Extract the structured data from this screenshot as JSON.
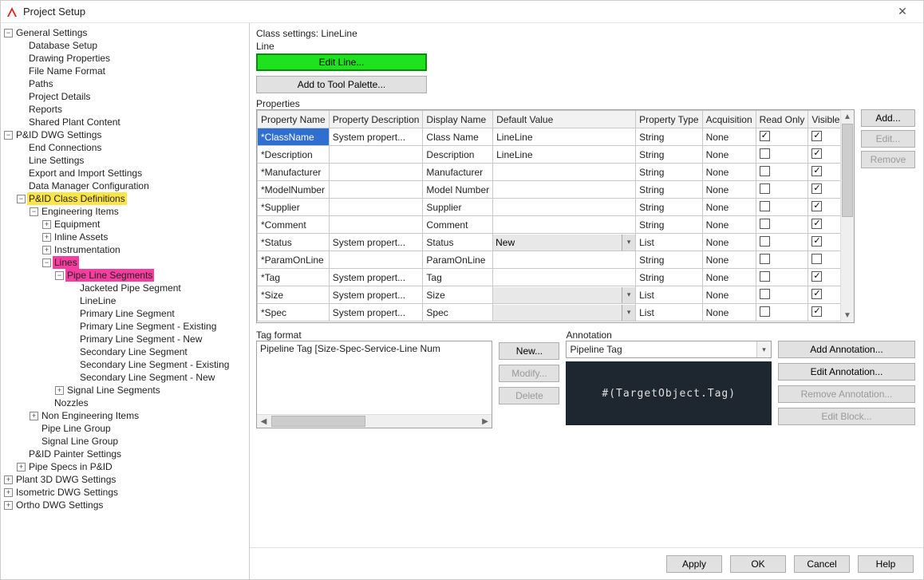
{
  "title": "Project Setup",
  "tree": {
    "general_settings": "General Settings",
    "database_setup": "Database Setup",
    "drawing_properties": "Drawing Properties",
    "file_name_format": "File Name Format",
    "paths": "Paths",
    "project_details": "Project Details",
    "reports": "Reports",
    "shared_plant_content": "Shared Plant Content",
    "pid_dwg_settings": "P&ID DWG Settings",
    "end_connections": "End Connections",
    "line_settings": "Line Settings",
    "export_import_settings": "Export and Import Settings",
    "data_manager_config": "Data Manager Configuration",
    "pid_class_definitions": "P&ID Class Definitions",
    "engineering_items": "Engineering Items",
    "equipment": "Equipment",
    "inline_assets": "Inline Assets",
    "instrumentation": "Instrumentation",
    "lines": "Lines",
    "pipe_line_segments": "Pipe Line Segments",
    "jacketed_pipe_segment": "Jacketed Pipe Segment",
    "lineline": "LineLine",
    "primary_line_segment": "Primary Line Segment",
    "primary_line_segment_existing": "Primary Line Segment - Existing",
    "primary_line_segment_new": "Primary Line Segment - New",
    "secondary_line_segment": "Secondary Line Segment",
    "secondary_line_segment_existing": "Secondary Line Segment - Existing",
    "secondary_line_segment_new": "Secondary Line Segment - New",
    "signal_line_segments": "Signal Line Segments",
    "nozzles": "Nozzles",
    "non_engineering_items": "Non Engineering Items",
    "pipe_line_group": "Pipe Line Group",
    "signal_line_group": "Signal Line Group",
    "pid_painter_settings": "P&ID Painter Settings",
    "pipe_specs": "Pipe Specs in P&ID",
    "plant3d_dwg": "Plant 3D DWG Settings",
    "isometric_dwg": "Isometric DWG Settings",
    "ortho_dwg": "Ortho DWG Settings"
  },
  "header_label": "Class settings: LineLine",
  "line_group_label": "Line",
  "edit_line_btn": "Edit Line...",
  "add_to_tool_palette_btn": "Add to Tool Palette...",
  "properties_label": "Properties",
  "columns": {
    "name": "Property Name",
    "desc": "Property Description",
    "display": "Display Name",
    "default": "Default Value",
    "type": "Property Type",
    "acq": "Acquisition",
    "ro": "Read Only",
    "vis": "Visible"
  },
  "rows": [
    {
      "name": "*ClassName",
      "desc": "System propert...",
      "display": "Class Name",
      "default": "LineLine",
      "type": "String",
      "acq": "None",
      "ro": true,
      "vis": true,
      "selected": true
    },
    {
      "name": "*Description",
      "desc": "",
      "display": "Description",
      "default": "LineLine",
      "type": "String",
      "acq": "None",
      "ro": false,
      "vis": true
    },
    {
      "name": "*Manufacturer",
      "desc": "",
      "display": "Manufacturer",
      "default": "",
      "type": "String",
      "acq": "None",
      "ro": false,
      "vis": true
    },
    {
      "name": "*ModelNumber",
      "desc": "",
      "display": "Model Number",
      "default": "",
      "type": "String",
      "acq": "None",
      "ro": false,
      "vis": true
    },
    {
      "name": "*Supplier",
      "desc": "",
      "display": "Supplier",
      "default": "",
      "type": "String",
      "acq": "None",
      "ro": false,
      "vis": true
    },
    {
      "name": "*Comment",
      "desc": "",
      "display": "Comment",
      "default": "",
      "type": "String",
      "acq": "None",
      "ro": false,
      "vis": true
    },
    {
      "name": "*Status",
      "desc": "System propert...",
      "display": "Status",
      "default": "New",
      "type": "List",
      "acq": "None",
      "ro": false,
      "vis": true,
      "dd": true
    },
    {
      "name": "*ParamOnLine",
      "desc": "",
      "display": "ParamOnLine",
      "default": "",
      "type": "String",
      "acq": "None",
      "ro": false,
      "vis": false
    },
    {
      "name": "*Tag",
      "desc": "System propert...",
      "display": "Tag",
      "default": "",
      "type": "String",
      "acq": "None",
      "ro": false,
      "vis": true
    },
    {
      "name": "*Size",
      "desc": "System propert...",
      "display": "Size",
      "default": "",
      "type": "List",
      "acq": "None",
      "ro": false,
      "vis": true,
      "dd": true
    },
    {
      "name": "*Spec",
      "desc": "System propert...",
      "display": "Spec",
      "default": "",
      "type": "List",
      "acq": "None",
      "ro": false,
      "vis": true,
      "dd": true
    }
  ],
  "side_buttons": {
    "add": "Add...",
    "edit": "Edit...",
    "remove": "Remove"
  },
  "tag_format_label": "Tag format",
  "tag_format_text": "Pipeline Tag [Size-Spec-Service-Line Num",
  "tag_buttons": {
    "new": "New...",
    "modify": "Modify...",
    "delete": "Delete"
  },
  "annotation_label": "Annotation",
  "annotation_select": "Pipeline Tag",
  "annotation_preview": "#(TargetObject.Tag)",
  "annotation_buttons": {
    "add": "Add Annotation...",
    "edit": "Edit Annotation...",
    "remove": "Remove Annotation...",
    "block": "Edit Block..."
  },
  "footer": {
    "apply": "Apply",
    "ok": "OK",
    "cancel": "Cancel",
    "help": "Help"
  }
}
